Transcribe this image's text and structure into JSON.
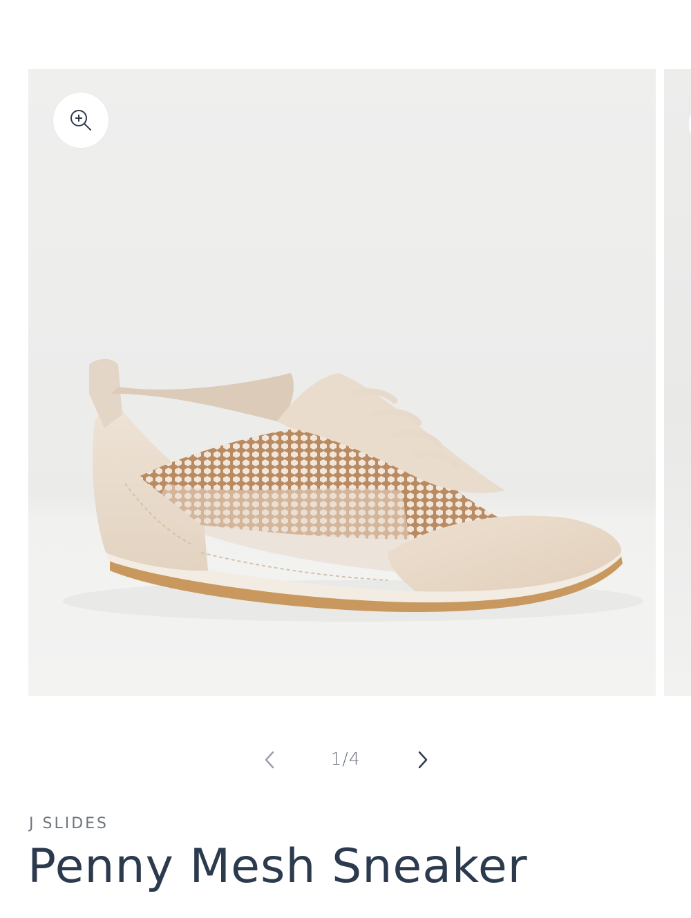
{
  "gallery": {
    "zoom_icon": "zoom-in-icon",
    "image_alt": "Penny Mesh Sneaker",
    "colors": {
      "background": "#eeeeed",
      "shoe_upper": "#eadccc",
      "shoe_mesh": "#c9a27f",
      "shoe_sole": "#c99860"
    }
  },
  "pager": {
    "prev_icon": "chevron-left-icon",
    "next_icon": "chevron-right-icon",
    "count": "1/4",
    "current": 1,
    "total": 4
  },
  "product": {
    "vendor": "J SLIDES",
    "title": "Penny Mesh Sneaker"
  },
  "theme": {
    "title_color": "#2c3a4e",
    "muted_color": "#6f7680"
  }
}
